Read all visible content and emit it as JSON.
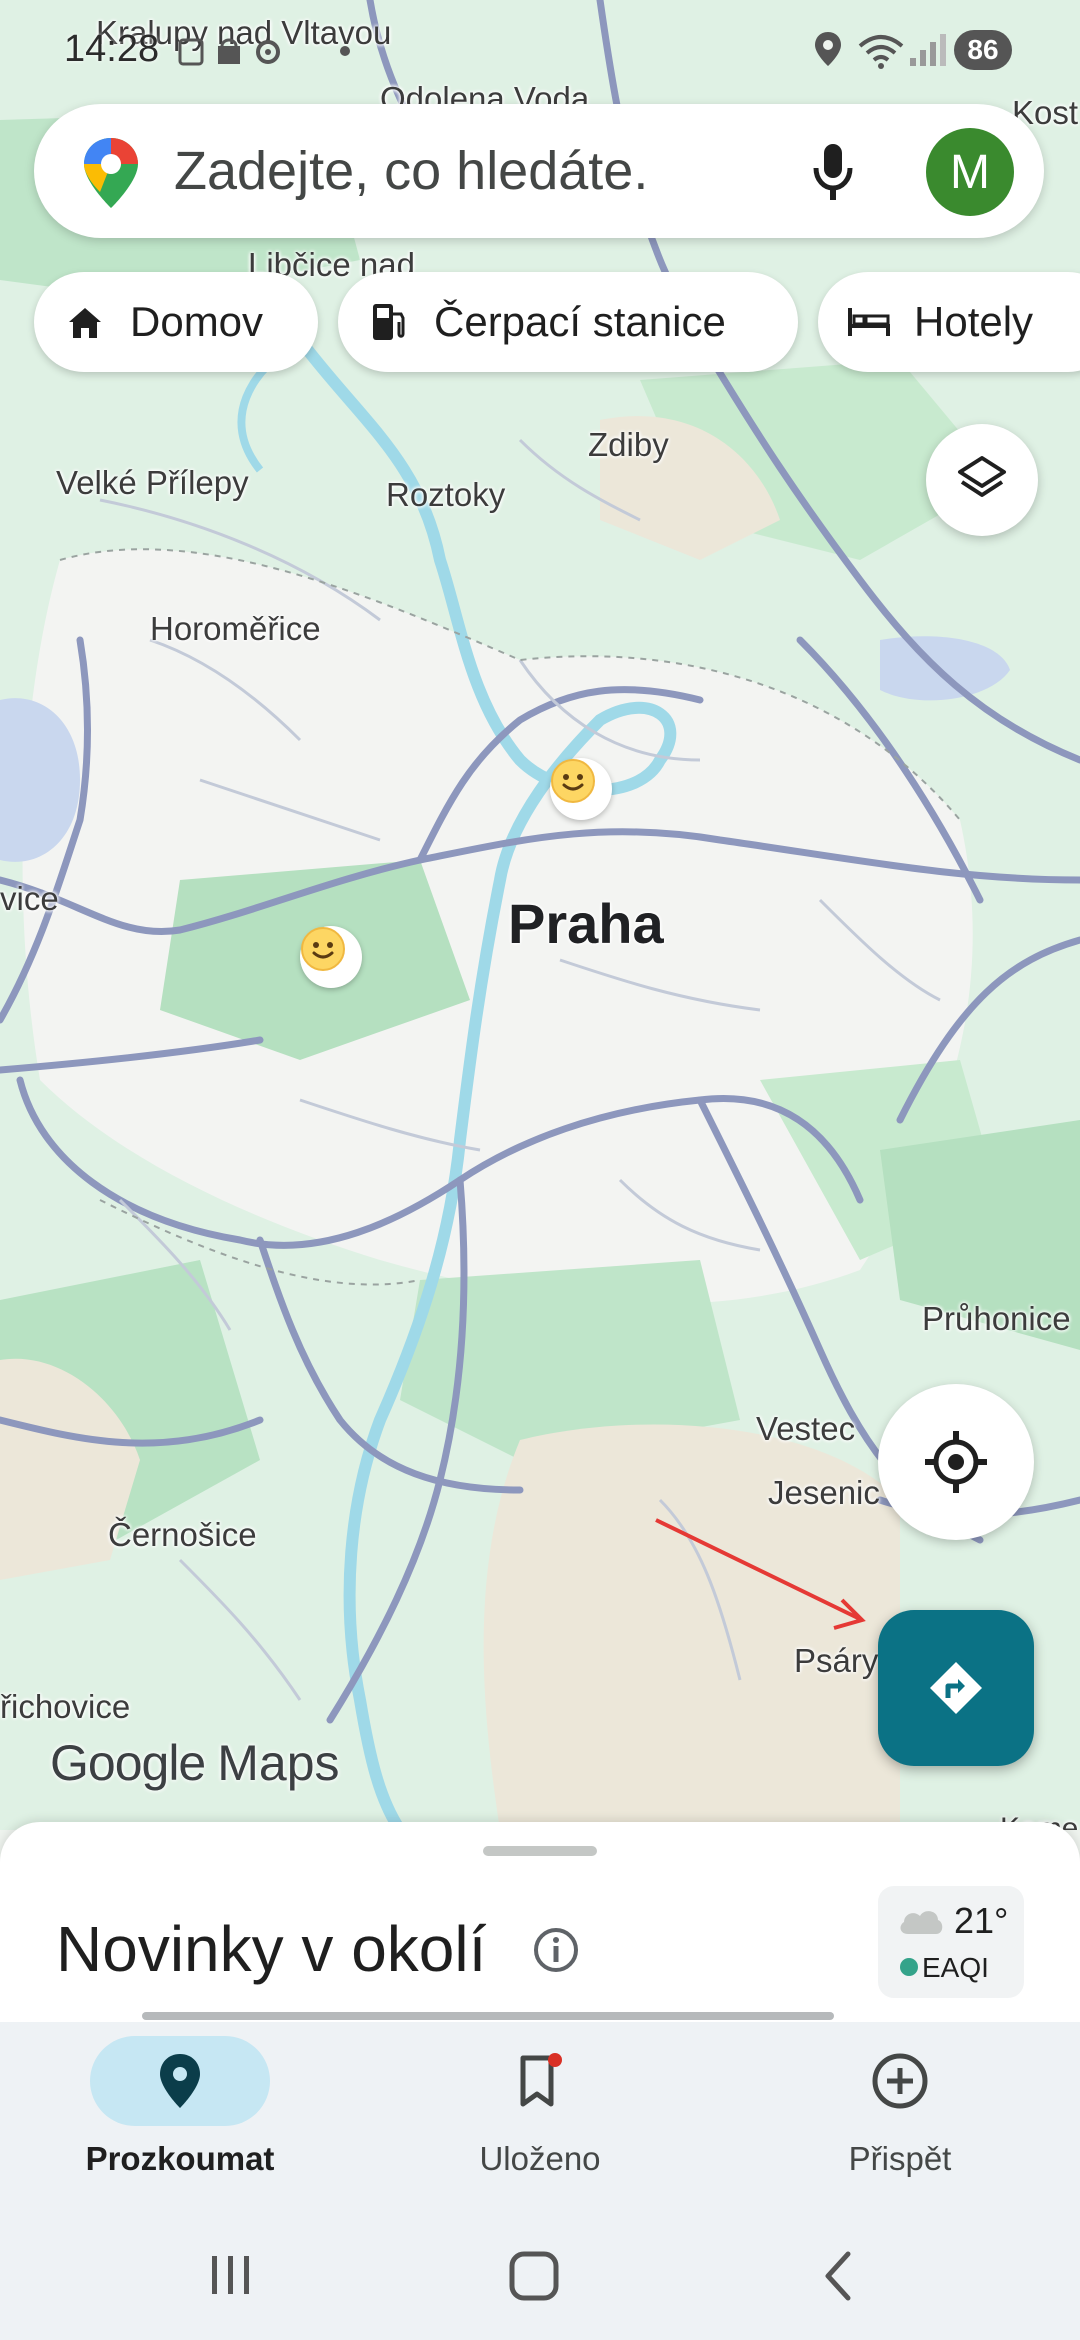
{
  "status_bar": {
    "time": "14:28",
    "battery": "86"
  },
  "search": {
    "placeholder": "Zadejte, co hledáte.",
    "avatar_initial": "M"
  },
  "chips": [
    {
      "label": "Domov",
      "icon": "home-icon"
    },
    {
      "label": "Čerpací stanice",
      "icon": "gas-station-icon"
    },
    {
      "label": "Hotely",
      "icon": "bed-icon"
    }
  ],
  "map": {
    "labels": {
      "kralupy": "Kralupy nad Vltavou",
      "odolena": "Odolena Voda",
      "kost": "Kost",
      "libcice": "Libčice nad",
      "zdiby": "Zdiby",
      "velke_prilepy": "Velké Přílepy",
      "roztoky": "Roztoky",
      "horomerice": "Horoměřice",
      "praha": "Praha",
      "vice": "vice",
      "pruhonice": "Průhonice",
      "vestec": "Vestec",
      "jesenice": "Jesenic",
      "cernosice": "Černošice",
      "psary": "Psáry",
      "richovice": "řichovice",
      "kame": "Kame"
    },
    "logo_brand": "Google",
    "logo_product": "Maps"
  },
  "bottom_sheet": {
    "title": "Novinky v okolí",
    "weather_temp": "21°",
    "weather_aqi": "EAQI"
  },
  "nav": [
    {
      "label": "Prozkoumat",
      "icon": "location-pin-icon",
      "active": true
    },
    {
      "label": "Uloženo",
      "icon": "bookmark-icon",
      "active": false
    },
    {
      "label": "Přispět",
      "icon": "add-circle-icon",
      "active": false
    }
  ],
  "colors": {
    "map_green": "#bfe5c9",
    "map_land": "#f4f4f2",
    "map_road": "#8d97bd",
    "water": "#9fd9e8",
    "accent_teal": "#0b7285",
    "avatar_green": "#3a8a2e",
    "nav_active_pill": "#c6e7f3"
  }
}
